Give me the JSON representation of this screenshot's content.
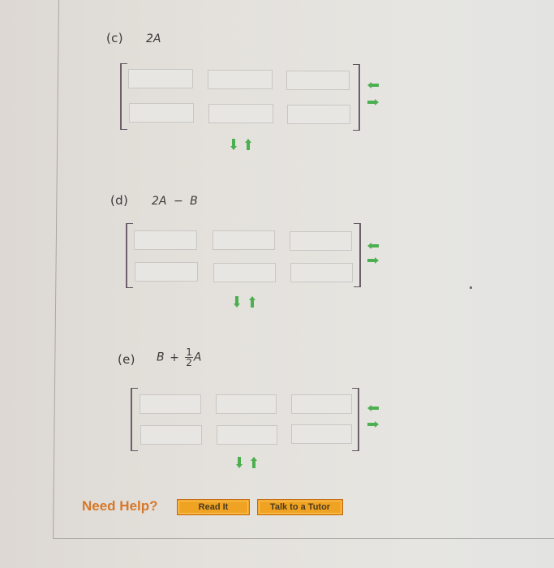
{
  "parts": [
    {
      "id": "c",
      "label": "(c)",
      "expression": {
        "lhs": "2A"
      },
      "matrix": {
        "rows": 2,
        "cols": 3,
        "cells": [
          [
            "",
            "",
            ""
          ],
          [
            "",
            "",
            ""
          ]
        ]
      }
    },
    {
      "id": "d",
      "label": "(d)",
      "expression": {
        "lhs": "2A",
        "op": "−",
        "rhs": "B"
      },
      "matrix": {
        "rows": 2,
        "cols": 3,
        "cells": [
          [
            "",
            "",
            ""
          ],
          [
            "",
            "",
            ""
          ]
        ]
      }
    },
    {
      "id": "e",
      "label": "(e)",
      "expression": {
        "lhs": "B",
        "op": "+",
        "frac_num": "1",
        "frac_den": "2",
        "rhs": "A"
      },
      "matrix": {
        "rows": 2,
        "cols": 3,
        "cells": [
          [
            "",
            "",
            ""
          ],
          [
            "",
            "",
            ""
          ]
        ]
      }
    }
  ],
  "help": {
    "label": "Need Help?",
    "buttons": [
      {
        "label": "Read It"
      },
      {
        "label": "Talk to a Tutor"
      }
    ]
  },
  "icons": {
    "row_remove": "arrow-left-icon",
    "row_add": "arrow-right-icon",
    "col_remove": "arrow-down-icon",
    "col_add": "arrow-up-icon"
  },
  "colors": {
    "arrow_green": "#4caf50",
    "help_orange": "#d6782a",
    "button_orange": "#f0a322"
  }
}
